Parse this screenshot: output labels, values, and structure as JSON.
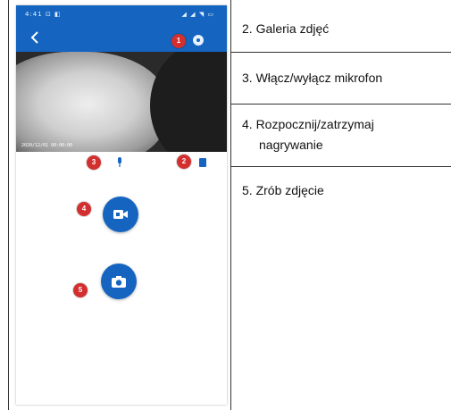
{
  "phone": {
    "status_left": "4:41 ⊡ ◧",
    "status_right": "◢ ◢ ◥ ▭",
    "video_timestamp": "2020/12/01  00:00:00",
    "badges": [
      "1",
      "2",
      "3",
      "4",
      "5"
    ],
    "icons": {
      "back": "chevron-left",
      "settings": "gear",
      "fullscreen": "expand",
      "microphone": "mic",
      "gallery": "gallery",
      "record": "video-camera",
      "snapshot": "camera"
    },
    "colors": {
      "appbar": "#1565c0",
      "badge": "#d32f2f"
    }
  },
  "legend": {
    "item2": "2. Galeria zdjęć",
    "item3": "3. Włącz/wyłącz mikrofon",
    "item4_line1": "4. Rozpocznij/zatrzymaj",
    "item4_line2": "nagrywanie",
    "item5": "5. Zrób zdjęcie"
  }
}
